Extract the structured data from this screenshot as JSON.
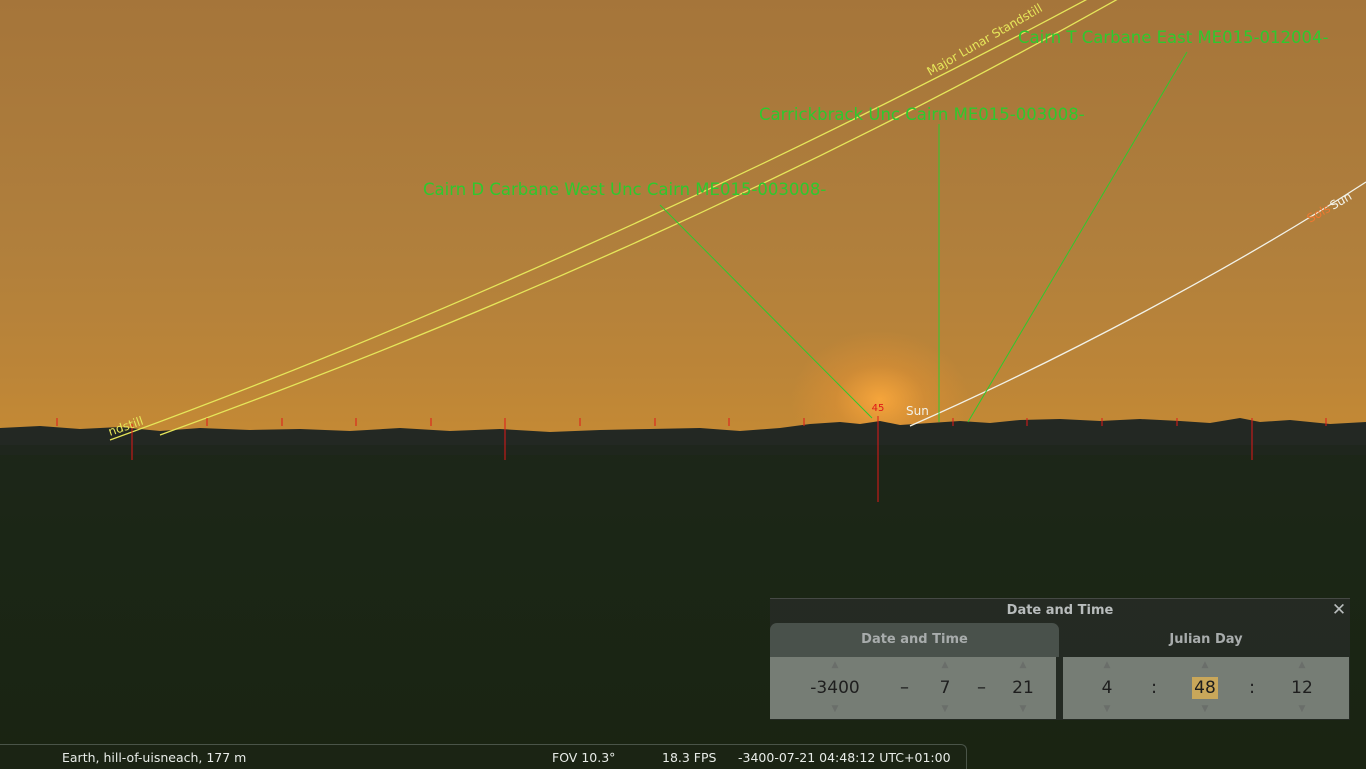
{
  "sky_labels": {
    "major_lunar_standstill": "Major Lunar Standstill",
    "standstill_fragment": "ndstill",
    "solstice_fragment": "Sols",
    "sun_line_label": "Sun",
    "sun_object": "Sun",
    "azimuth_marker": "45"
  },
  "landmarks": [
    {
      "name": "Cairn T Carbane East ME015-012004-"
    },
    {
      "name": "Carrickbrack Unc Cairn ME015-003008-"
    },
    {
      "name": "Cairn D Carbane West Unc Cairn ME015-003008-"
    }
  ],
  "colors": {
    "landmark_green": "#2ec92e",
    "lunar_line": "#e6e65a",
    "sun_line": "#f2f2e8",
    "tick_red": "#e01818",
    "solstice_orange": "#f07830",
    "highlight": "#c9a75a"
  },
  "dialog": {
    "title": "Date and Time",
    "tabs": {
      "date": "Date and Time",
      "julian": "Julian Day"
    },
    "date": {
      "year": "-3400",
      "month": "7",
      "day": "21",
      "sep": "–"
    },
    "time": {
      "hour": "4",
      "minute": "48",
      "second": "12",
      "sep": ":"
    },
    "close_icon": "close-icon"
  },
  "statusbar": {
    "location": "Earth, hill-of-uisneach, 177 m",
    "fov": "FOV 10.3°",
    "fps": "18.3 FPS",
    "datetime": "-3400-07-21 04:48:12 UTC+01:00"
  }
}
